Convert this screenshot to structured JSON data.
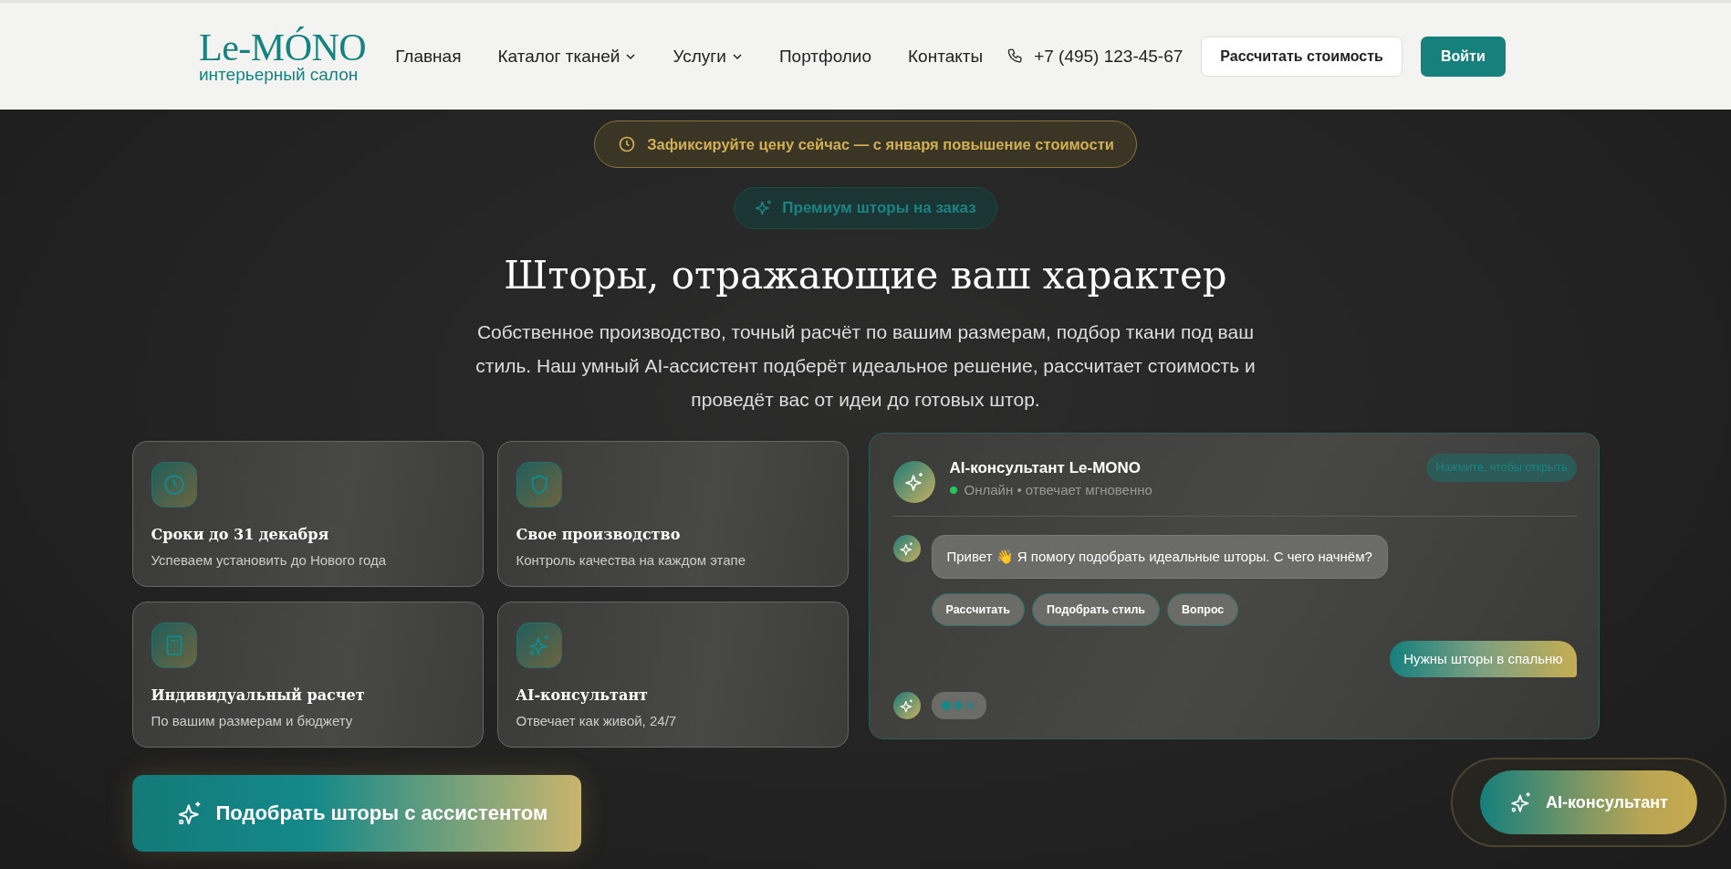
{
  "header": {
    "logo": {
      "name": "Le-MÓNO",
      "tagline": "интерьерный салон"
    },
    "nav": [
      {
        "label": "Главная",
        "dropdown": false
      },
      {
        "label": "Каталог тканей",
        "dropdown": true
      },
      {
        "label": "Услуги",
        "dropdown": true
      },
      {
        "label": "Портфолио",
        "dropdown": false
      },
      {
        "label": "Контакты",
        "dropdown": false
      }
    ],
    "phone": "+7 (495) 123-45-67",
    "buttons": [
      {
        "label": "Рассчитать стоимость",
        "kind": "outline"
      },
      {
        "label": "Войти",
        "kind": "primary"
      }
    ]
  },
  "hero": {
    "notice": "Зафиксируйте цену сейчас — с января повышение стоимости",
    "badge": "Премиум шторы на заказ",
    "title": "Шторы, отражающие ваш характер",
    "subtitle": "Собственное производство, точный расчёт по вашим размерам, подбор ткани под ваш стиль. Наш умный AI-ассистент подберёт идеальное решение, рассчитает стоимость и проведёт вас от идеи до готовых штор.",
    "features": [
      {
        "kind": "clock",
        "title": "Сроки до 31 декабря",
        "text": "Успеваем установить до Нового года"
      },
      {
        "kind": "shield",
        "title": "Свое производство",
        "text": "Контроль качества на каждом этапе"
      },
      {
        "kind": "calculator",
        "title": "Индивидуальный расчет",
        "text": "По вашим размерам и бюджету"
      },
      {
        "kind": "sparkles",
        "title": "AI-консультант",
        "text": "Отвечает как живой, 24/7"
      }
    ],
    "cta": "Подобрать шторы с ассистентом"
  },
  "chat": {
    "title": "AI-консультант Le-MONO",
    "status": "Онлайн • отвечает мгновенно",
    "online": true,
    "open_hint": "Нажмите, чтобы открыть",
    "messages": [
      {
        "kind": "bot",
        "text": "Привет 👋 Я помогу подобрать идеальные шторы. С чего начнём?"
      },
      {
        "kind": "replies",
        "options": [
          "Рассчитать",
          "Подобрать стиль",
          "Вопрос"
        ]
      },
      {
        "kind": "user",
        "text": "Нужны шторы в спальню"
      },
      {
        "kind": "typing"
      }
    ]
  },
  "floating_button": "AI-консультант"
}
